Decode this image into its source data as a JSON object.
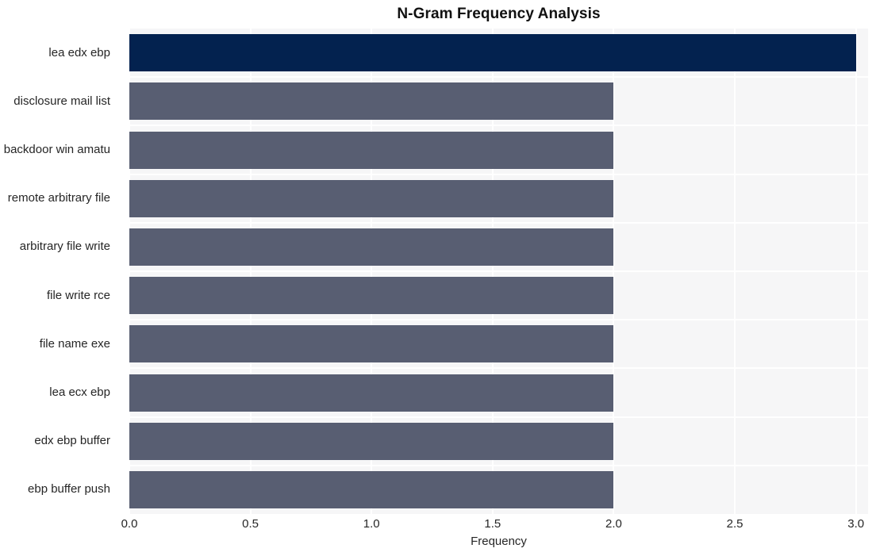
{
  "chart_data": {
    "type": "bar",
    "orientation": "horizontal",
    "title": "N-Gram Frequency Analysis",
    "xlabel": "Frequency",
    "ylabel": "",
    "categories": [
      "lea edx ebp",
      "disclosure mail list",
      "backdoor win amatu",
      "remote arbitrary file",
      "arbitrary file write",
      "file write rce",
      "file name exe",
      "lea ecx ebp",
      "edx ebp buffer",
      "ebp buffer push"
    ],
    "values": [
      3,
      2,
      2,
      2,
      2,
      2,
      2,
      2,
      2,
      2
    ],
    "xlim": [
      0,
      3.05
    ],
    "xticks": [
      "0.0",
      "0.5",
      "1.0",
      "1.5",
      "2.0",
      "2.5",
      "3.0"
    ],
    "xtick_values": [
      0.0,
      0.5,
      1.0,
      1.5,
      2.0,
      2.5,
      3.0
    ],
    "grid": true,
    "legend": null,
    "highlight_index": 0,
    "colors": {
      "bar": "#585e72",
      "bar_highlight": "#03224f",
      "plot_background": "#f6f6f7",
      "gridline": "#ffffff",
      "figure_background": "#ffffff",
      "text": "#262626",
      "title": "#111111"
    }
  }
}
